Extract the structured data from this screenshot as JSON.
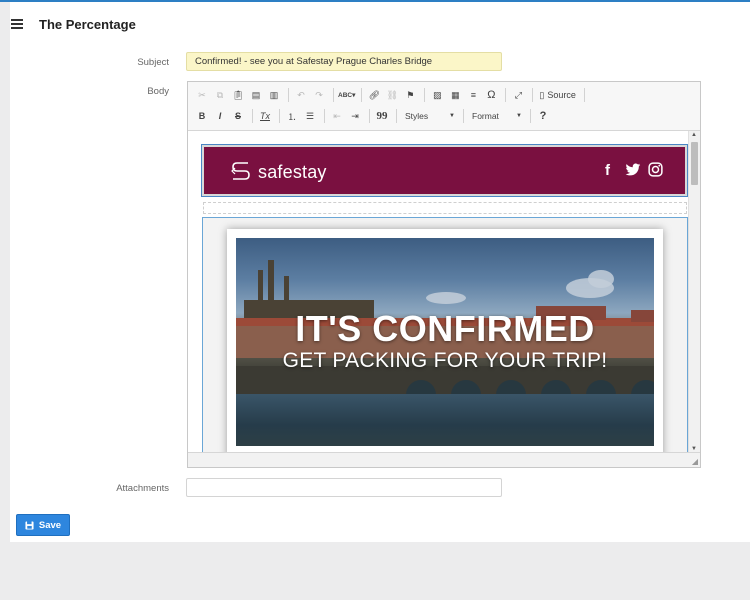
{
  "app": {
    "title": "The Percentage"
  },
  "form": {
    "subject_label": "Subject",
    "subject_value": "Confirmed! - see you at Safestay Prague Charles Bridge",
    "body_label": "Body",
    "attachments_label": "Attachments",
    "attachments_value": "",
    "save_label": "Save"
  },
  "toolbar": {
    "row1": [
      "cut-icon",
      "copy-icon",
      "paste-icon",
      "paste-text-icon",
      "paste-word-icon",
      "undo-icon",
      "redo-icon",
      "spellcheck-icon",
      "link-icon",
      "unlink-icon",
      "anchor-icon",
      "image-icon",
      "table-icon",
      "horizontal-rule-icon",
      "special-char-icon",
      "maximize-icon",
      "source-icon"
    ],
    "source_label": "Source",
    "styles_label": "Styles",
    "format_label": "Format",
    "bold_glyph": "B",
    "italic_glyph": "I",
    "strike_glyph": "S",
    "removeformat_glyph": "Tx",
    "help_glyph": "?",
    "blockquote_glyph": "99",
    "omega_glyph": "Ω",
    "spell_glyph": "ABC"
  },
  "email": {
    "brand": "safestay",
    "header_color": "#7a1040",
    "hero_title": "IT'S CONFIRMED",
    "hero_subtitle": "GET PACKING FOR YOUR TRIP!"
  },
  "colors": {
    "accent": "#2e86de",
    "subject_bg": "#fbf6c8"
  }
}
